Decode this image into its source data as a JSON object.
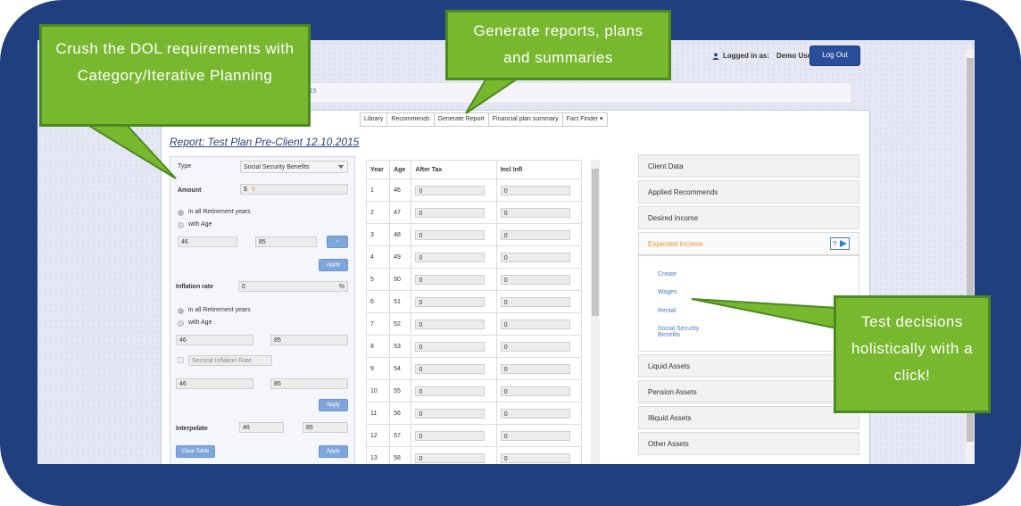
{
  "header": {
    "logged_in_label": "Logged in as:",
    "user_name": "Demo User",
    "logout_label": "Log Out",
    "breadcrumb_fragment": "015"
  },
  "tabs": [
    {
      "label": "Library"
    },
    {
      "label": "Recommends"
    },
    {
      "label": "Generate Report"
    },
    {
      "label": "Financial plan summary"
    },
    {
      "label": "Fact Finder ▾"
    }
  ],
  "report": {
    "title": "Report: Test Plan Pre-Client 12.10.2015"
  },
  "form": {
    "type_label": "Type",
    "type_value": "Social Security Benefits",
    "amount_label": "Amount",
    "currency": "$",
    "amount_value": "0",
    "radio_all_years": "in all Retirement years",
    "radio_with_age": "with Age",
    "age_from": "46",
    "age_to": "85",
    "apply_label": "Apply",
    "inflation_label": "Inflation rate",
    "inflation_value": "0",
    "percent": "%",
    "radio_all_years_2": "in all Retirement years",
    "radio_with_age_2": "with Age",
    "age_from_2": "46",
    "age_to_2": "85",
    "second_inflation_label": "Second Inflation Rate",
    "age_from_3": "46",
    "age_to_3": "85",
    "apply_label_2": "Apply",
    "interpolate_label": "Interpolate",
    "interp_from": "46",
    "interp_to": "85",
    "clear_table_label": "Clear Table",
    "apply_label_3": "Apply",
    "chevron": "‹"
  },
  "table": {
    "headers": [
      "Year",
      "Age",
      "After Tax",
      "Incl Infl"
    ],
    "rows": [
      {
        "year": "1",
        "age": "46",
        "after_tax": "0",
        "incl_infl": "0"
      },
      {
        "year": "2",
        "age": "47",
        "after_tax": "0",
        "incl_infl": "0"
      },
      {
        "year": "3",
        "age": "48",
        "after_tax": "0",
        "incl_infl": "0"
      },
      {
        "year": "4",
        "age": "49",
        "after_tax": "0",
        "incl_infl": "0"
      },
      {
        "year": "5",
        "age": "50",
        "after_tax": "0",
        "incl_infl": "0"
      },
      {
        "year": "6",
        "age": "51",
        "after_tax": "0",
        "incl_infl": "0"
      },
      {
        "year": "7",
        "age": "52",
        "after_tax": "0",
        "incl_infl": "0"
      },
      {
        "year": "8",
        "age": "53",
        "after_tax": "0",
        "incl_infl": "0"
      },
      {
        "year": "9",
        "age": "54",
        "after_tax": "0",
        "incl_infl": "0"
      },
      {
        "year": "10",
        "age": "55",
        "after_tax": "0",
        "incl_infl": "0"
      },
      {
        "year": "11",
        "age": "56",
        "after_tax": "0",
        "incl_infl": "0"
      },
      {
        "year": "12",
        "age": "57",
        "after_tax": "0",
        "incl_infl": "0"
      },
      {
        "year": "13",
        "age": "58",
        "after_tax": "0",
        "incl_infl": "0"
      }
    ]
  },
  "sidebar": {
    "items": [
      {
        "label": "Client Data"
      },
      {
        "label": "Applied Recommends"
      },
      {
        "label": "Desired Income"
      },
      {
        "label": "Expected Income"
      },
      {
        "label": "Liquid Assets"
      },
      {
        "label": "Pension Assets"
      },
      {
        "label": "Illiquid Assets"
      },
      {
        "label": "Other Assets"
      }
    ],
    "expected_links": [
      {
        "label": "Create"
      },
      {
        "label": "Wages"
      },
      {
        "label": "Rental"
      },
      {
        "label": "Social Security Benefits"
      }
    ],
    "help_label": "?"
  },
  "callouts": {
    "dol": "Crush the DOL requirements with Category/Iterative Planning",
    "reports": "Generate reports, plans and summaries",
    "test": "Test decisions holistically with a click!"
  },
  "colors": {
    "frame": "#1f3f7f",
    "callout_green": "#77b82f",
    "accent_orange": "#e8902c",
    "link_blue": "#4a7dc7"
  }
}
